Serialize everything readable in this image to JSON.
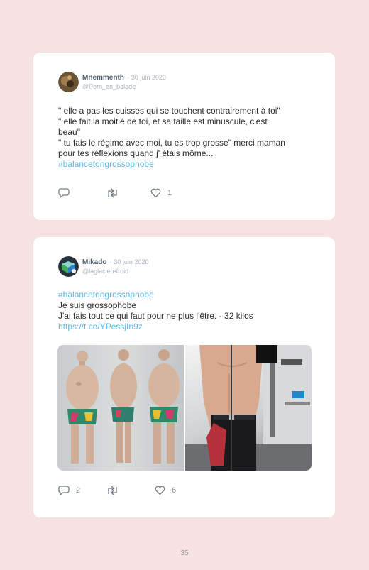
{
  "tweets": [
    {
      "name": "Mnemmenth",
      "date": "· 30 juin 2020",
      "handle": "@Pern_en_balade",
      "lines": [
        "\" elle a pas les cuisses qui se touchent contrairement à toi\"",
        "\" elle fait la moitié de toi, et sa taille est minuscule, c'est",
        "beau\"",
        "\" tu fais le régime avec moi, tu es trop grosse\" merci maman",
        "pour tes réflexions quand j' étais môme..."
      ],
      "hashtag": "#balancetongrossophobe",
      "replies": "",
      "likes": "1"
    },
    {
      "name": "Mikado",
      "date": "· 30 juin 2020",
      "handle": "@laglacierefroid",
      "hashtag": "#balancetongrossophobe",
      "lines": [
        "Je suis grossophobe",
        "J'ai fais tout ce qui faut pour ne plus l'être. - 32 kilos"
      ],
      "link": "https://t.co/YPessjIn9z",
      "replies": "2",
      "likes": "6"
    }
  ],
  "page_number": "35",
  "icons": {
    "reply": "reply-icon",
    "retweet": "retweet-icon",
    "like": "heart-icon"
  },
  "colors": {
    "background": "#f6e2e2",
    "card": "#ffffff",
    "hashtag": "#5fb7e6",
    "name": "#50606e",
    "muted": "#a9b4bd"
  }
}
